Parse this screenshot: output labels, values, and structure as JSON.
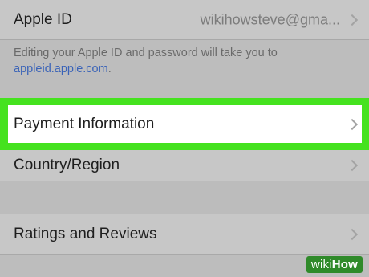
{
  "settings": {
    "apple_id": {
      "label": "Apple ID",
      "value": "wikihowsteve@gma..."
    },
    "footer": {
      "text": "Editing your Apple ID and password will take you to",
      "link": "appleid.apple.com",
      "suffix": "."
    },
    "payment": {
      "label": "Payment Information"
    },
    "country": {
      "label": "Country/Region"
    },
    "ratings": {
      "label": "Ratings and Reviews"
    }
  },
  "colors": {
    "highlight": "#45e21f",
    "link": "#3a63b8",
    "watermark_bg": "#2f8a2a"
  },
  "watermark": {
    "prefix": "wiki",
    "suffix": "How"
  }
}
